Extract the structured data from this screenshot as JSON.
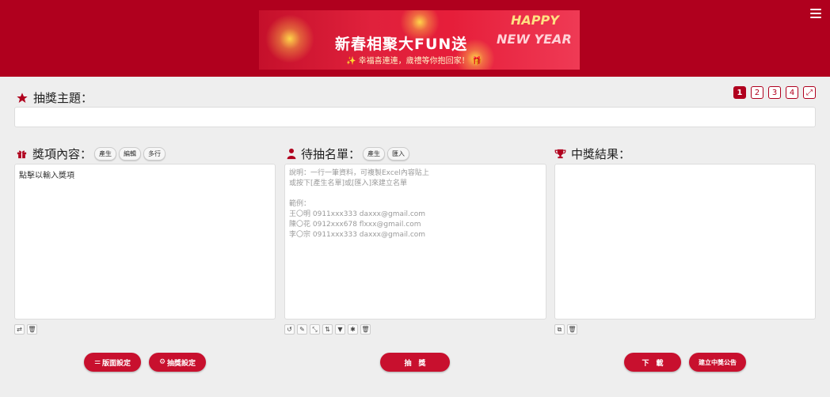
{
  "banner": {
    "title": "新春相聚大FUN送",
    "subtitle": "✨ 幸福喜連連，歲禮等你抱回家！ 🎁",
    "happy": "HAPPY",
    "new_year": "NEW YEAR"
  },
  "theme": {
    "label": "抽獎主題："
  },
  "pager": [
    "1",
    "2",
    "3",
    "4"
  ],
  "prizes": {
    "label": "獎項內容：",
    "chips": [
      "產生",
      "編輯",
      "多行"
    ],
    "placeholder": "點擊以輸入獎項"
  },
  "candidates": {
    "label": "待抽名單：",
    "chips": [
      "產生",
      "匯入"
    ],
    "hint_lines": [
      "說明：一行一筆資料，可複製Excel內容貼上",
      "或按下[產生名單]或[匯入]來建立名單",
      "",
      "範例：",
      "王〇明 0911xxx333 daxxx@gmail.com",
      "陳〇花 0912xxx678 flxxx@gmail.com",
      "李〇宗 0911xxx333 daxxx@gmail.com"
    ]
  },
  "results": {
    "label": "中獎結果："
  },
  "buttons": {
    "layout": "版面設定",
    "settings": "抽獎設定",
    "draw": "抽　獎",
    "download": "下　載",
    "announce": "建立中獎公告"
  },
  "colors": {
    "brand": "#b0001e",
    "button": "#c8102e"
  }
}
